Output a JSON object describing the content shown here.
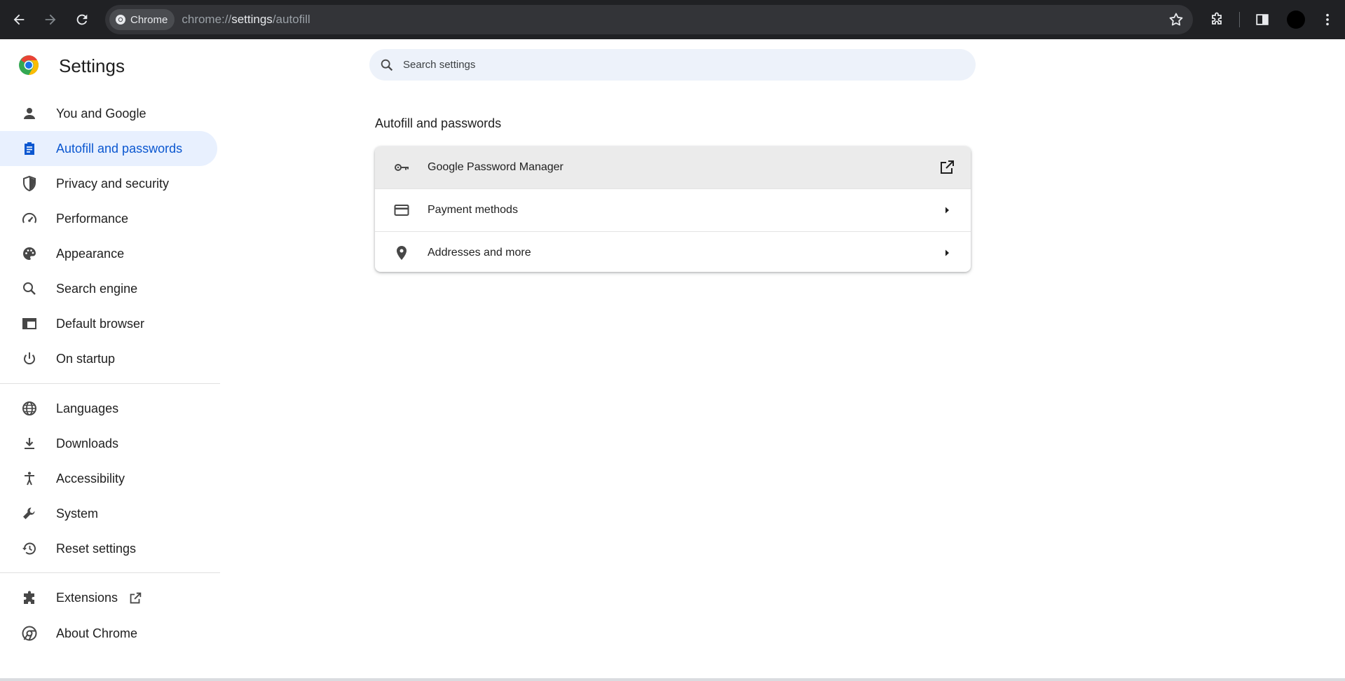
{
  "browser": {
    "chip_label": "Chrome",
    "url_scheme": "chrome://",
    "url_host": "settings",
    "url_path": "/autofill",
    "icons": [
      "back-icon",
      "forward-icon",
      "reload-icon",
      "bookmark-star-icon",
      "extensions-puzzle-icon",
      "side-panel-icon",
      "profile-avatar",
      "menu-kebab-icon"
    ]
  },
  "settings": {
    "title": "Settings",
    "search_placeholder": "Search settings"
  },
  "sidebar": {
    "items": [
      {
        "label": "You and Google",
        "icon": "person-icon"
      },
      {
        "label": "Autofill and passwords",
        "icon": "clipboard-icon",
        "active": true
      },
      {
        "label": "Privacy and security",
        "icon": "shield-icon"
      },
      {
        "label": "Performance",
        "icon": "speedometer-icon"
      },
      {
        "label": "Appearance",
        "icon": "palette-icon"
      },
      {
        "label": "Search engine",
        "icon": "search-icon"
      },
      {
        "label": "Default browser",
        "icon": "browser-window-icon"
      },
      {
        "label": "On startup",
        "icon": "power-icon"
      },
      {
        "label": "Languages",
        "icon": "globe-icon"
      },
      {
        "label": "Downloads",
        "icon": "download-icon"
      },
      {
        "label": "Accessibility",
        "icon": "accessibility-icon"
      },
      {
        "label": "System",
        "icon": "wrench-icon"
      },
      {
        "label": "Reset settings",
        "icon": "history-icon"
      },
      {
        "label": "Extensions",
        "icon": "puzzle-icon"
      },
      {
        "label": "About Chrome",
        "icon": "chrome-logo-icon"
      }
    ]
  },
  "main": {
    "section_title": "Autofill and passwords",
    "rows": [
      {
        "label": "Google Password Manager",
        "icon": "key-icon",
        "end_icon": "open-in-new-icon"
      },
      {
        "label": "Payment methods",
        "icon": "credit-card-icon",
        "end_icon": "arrow-right-icon"
      },
      {
        "label": "Addresses and more",
        "icon": "location-pin-icon",
        "end_icon": "arrow-right-icon"
      }
    ]
  },
  "colors": {
    "accent": "#0b57d0",
    "active_bg": "#e8f0fe",
    "toolbar_bg": "#202124",
    "search_bg": "#edf2fa"
  }
}
